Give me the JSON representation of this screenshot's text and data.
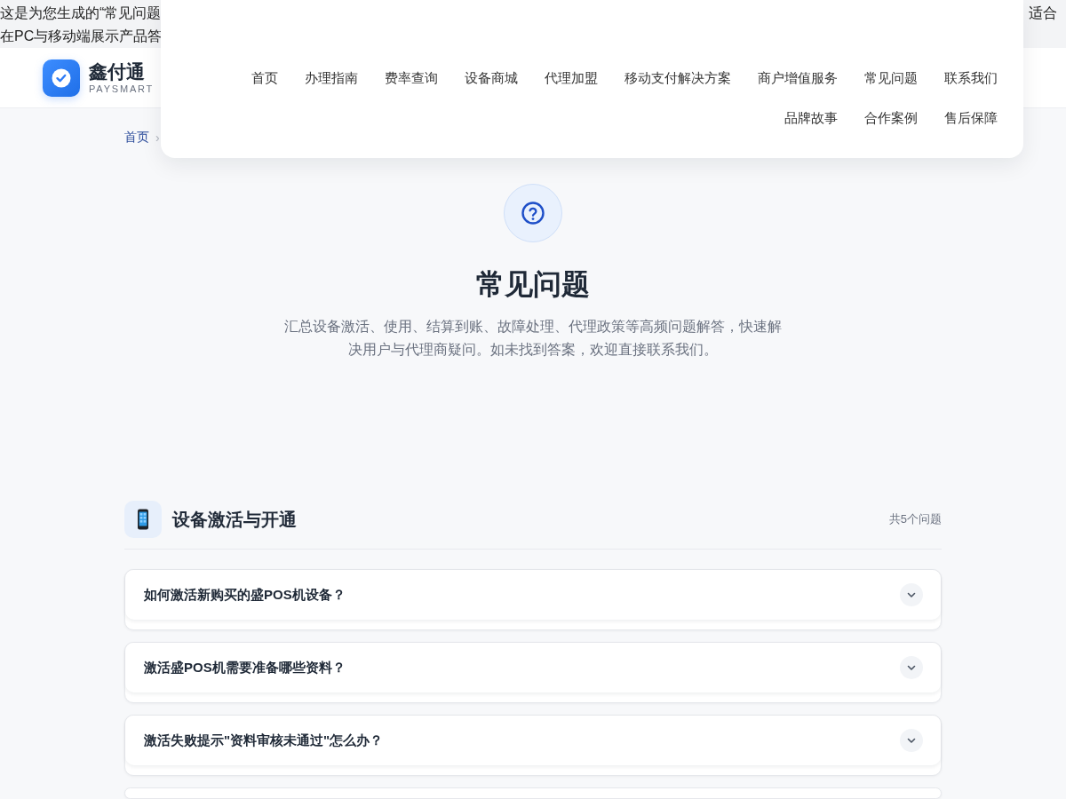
{
  "intro": {
    "line_1": "这是为您生成的“常见问题",
    "line_1_end": "适合",
    "line_2": "在PC与移动端展示产品答"
  },
  "header": {
    "brand": "鑫付通",
    "tagline": "PAYSMART"
  },
  "nav_menu": {
    "items": [
      "首页",
      "办理指南",
      "费率查询",
      "设备商城",
      "代理加盟",
      "移动支付解决方案",
      "商户增值服务",
      "常见问题",
      "联系我们",
      "品牌故事",
      "合作案例",
      "售后保障"
    ]
  },
  "breadcrumb": {
    "items": [
      "首页"
    ],
    "separator": "›"
  },
  "hero": {
    "title": "常见问题",
    "description": "汇总设备激活、使用、结算到账、故障处理、代理政策等高频问题解答，快速解决用户与代理商疑问。如未找到答案，欢迎直接联系我们。"
  },
  "category": {
    "title": "设备激活与开通",
    "count": "共5个问题"
  },
  "faq_items": [
    {
      "question": "如何激活新购买的盛POS机设备？",
      "expanded": false
    },
    {
      "question": "激活盛POS机需要准备哪些资料？",
      "expanded": false
    },
    {
      "question": "激活失败提示\"资料审核未通过\"怎么办？",
      "expanded": false
    }
  ],
  "partial_item": true
}
